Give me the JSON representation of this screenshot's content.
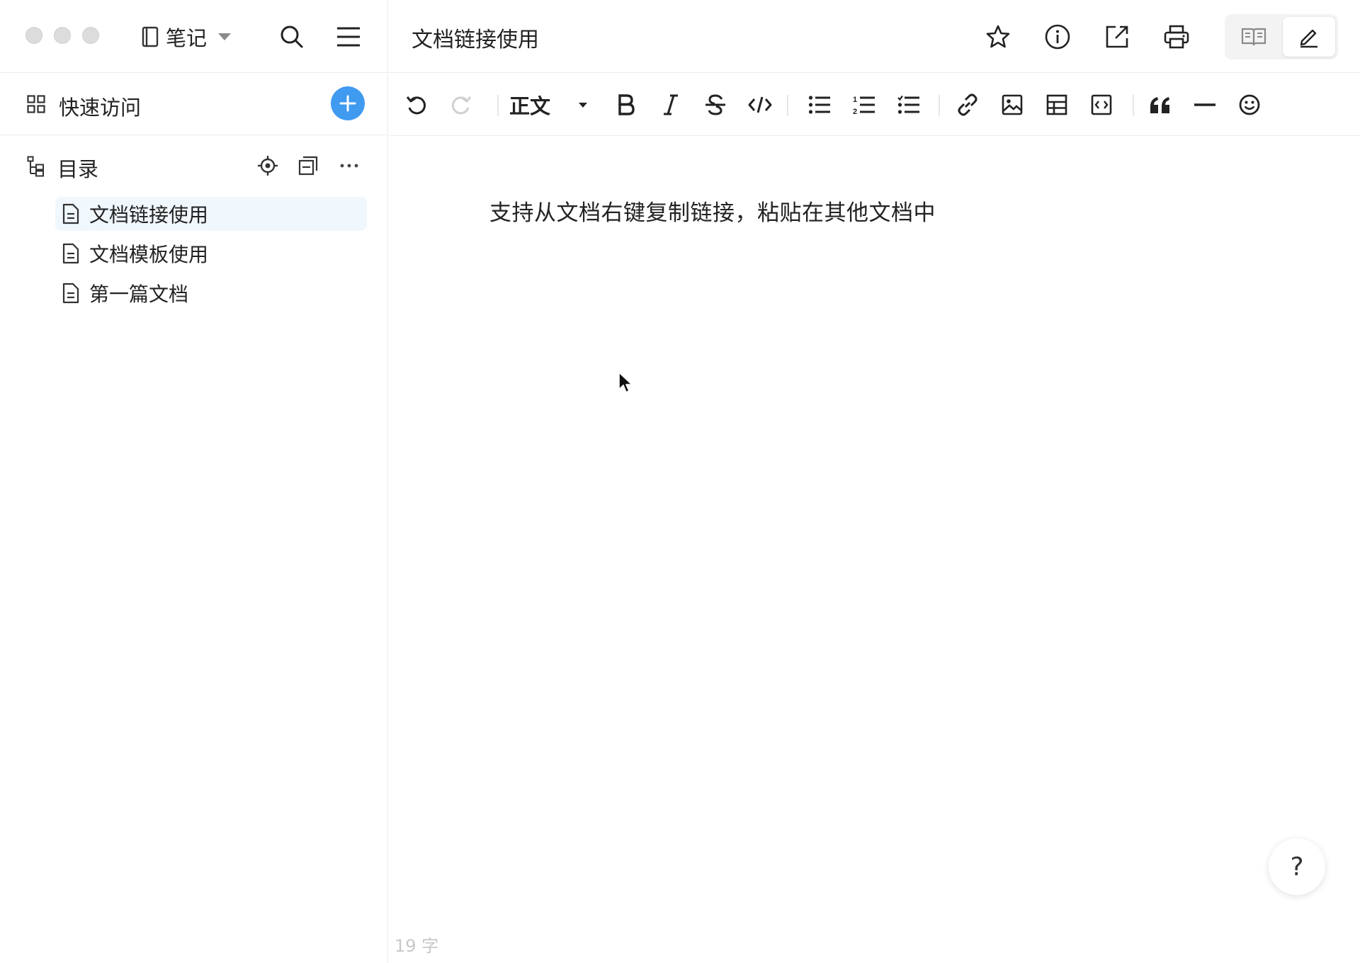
{
  "sidebar": {
    "notebook_label": "笔记",
    "quick_access_label": "快速访问",
    "toc_label": "目录",
    "documents": [
      {
        "title": "文档链接使用",
        "active": true
      },
      {
        "title": "文档模板使用",
        "active": false
      },
      {
        "title": "第一篇文档",
        "active": false
      }
    ]
  },
  "main": {
    "title": "文档链接使用",
    "toolbar": {
      "heading_label": "正文"
    },
    "content_text": "支持从文档右键复制链接，粘贴在其他文档中",
    "word_count": "19 字",
    "help_label": "?"
  },
  "colors": {
    "accent": "#3f9af0",
    "active_item_bg": "#f0f7fd",
    "divider": "#ececec",
    "muted_text": "#c8c8c8"
  },
  "icons": [
    "notebook-icon",
    "search-icon",
    "menu-icon",
    "grid-icon",
    "plus-icon",
    "tree-icon",
    "locate-icon",
    "collapse-icon",
    "more-icon",
    "document-icon",
    "star-icon",
    "info-icon",
    "export-icon",
    "print-icon",
    "read-mode-icon",
    "edit-mode-icon",
    "undo-icon",
    "redo-icon",
    "bold-icon",
    "italic-icon",
    "strikethrough-icon",
    "code-icon",
    "bullet-list-icon",
    "numbered-list-icon",
    "task-list-icon",
    "link-icon",
    "image-icon",
    "table-icon",
    "code-block-icon",
    "quote-icon",
    "horizontal-rule-icon",
    "emoji-icon",
    "help-icon"
  ]
}
